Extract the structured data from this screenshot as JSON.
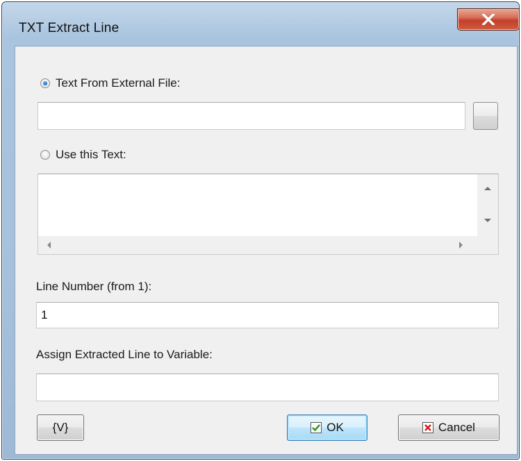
{
  "window": {
    "title": "TXT Extract Line"
  },
  "source": {
    "external_file_label": "Text From External File:",
    "external_file_value": "",
    "browse_label": "...",
    "use_text_label": "Use this Text:",
    "text_value": "",
    "selected": "external_file"
  },
  "line_number": {
    "label": "Line Number (from 1):",
    "value": "1"
  },
  "assign_variable": {
    "label": "Assign Extracted Line to Variable:",
    "value": ""
  },
  "buttons": {
    "variables_label": "{V}",
    "ok_label": "OK",
    "cancel_label": "Cancel"
  },
  "icons": {
    "close": "close-icon",
    "ok": "checkmark-icon",
    "cancel": "x-mark-icon"
  },
  "colors": {
    "close_button": "#c2412a",
    "ok_check": "#2d9a1f",
    "cancel_x": "#d21b1b"
  }
}
